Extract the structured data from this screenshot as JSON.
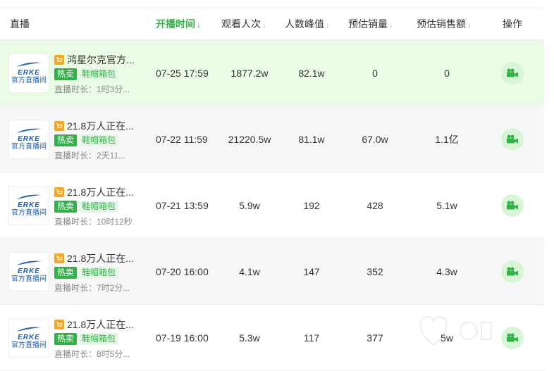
{
  "header": {
    "live": "直播",
    "start_time": "开播时间",
    "views": "观看人次",
    "peak": "人数峰值",
    "sales": "预估销量",
    "amount": "预估销售额",
    "op": "操作"
  },
  "logo": {
    "brand": "ERKE",
    "sub": "官方直播间"
  },
  "rows": [
    {
      "title": "鸿星尔克官方...",
      "tag_hot": "热卖",
      "tag_cat": "鞋帽箱包",
      "duration": "直播时长：1时3分...",
      "time": "07-25 17:59",
      "views": "1877.2w",
      "peak": "82.1w",
      "sales": "0",
      "amount": "0"
    },
    {
      "title": "21.8万人正在...",
      "tag_hot": "热卖",
      "tag_cat": "鞋帽箱包",
      "duration": "直播时长：2天11...",
      "time": "07-22 11:59",
      "views": "21220.5w",
      "peak": "81.1w",
      "sales": "67.0w",
      "amount": "1.1亿"
    },
    {
      "title": "21.8万人正在...",
      "tag_hot": "热卖",
      "tag_cat": "鞋帽箱包",
      "duration": "直播时长：10时12秒",
      "time": "07-21 13:59",
      "views": "5.9w",
      "peak": "192",
      "sales": "428",
      "amount": "5.1w"
    },
    {
      "title": "21.8万人正在...",
      "tag_hot": "热卖",
      "tag_cat": "鞋帽箱包",
      "duration": "直播时长：7时2分...",
      "time": "07-20 16:00",
      "views": "4.1w",
      "peak": "147",
      "sales": "352",
      "amount": "4.3w"
    },
    {
      "title": "21.8万人正在...",
      "tag_hot": "热卖",
      "tag_cat": "鞋帽箱包",
      "duration": "直播时长：8时5分...",
      "time": "07-19 16:00",
      "views": "5.3w",
      "peak": "117",
      "sales": "377",
      "amount": "5w"
    }
  ],
  "colors": {
    "accent": "#2fb344",
    "highlight_row": "#eafbe6",
    "cart": "#f5a623",
    "brand_blue": "#1a5fb4"
  }
}
